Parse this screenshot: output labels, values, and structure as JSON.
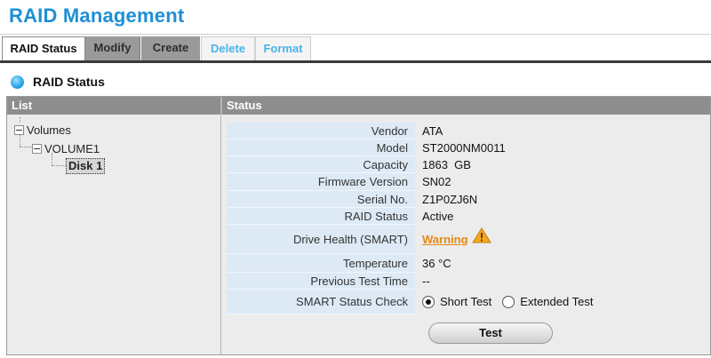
{
  "page": {
    "title": "RAID Management"
  },
  "tabs": [
    {
      "label": "RAID Status",
      "active": true
    },
    {
      "label": "Modify"
    },
    {
      "label": "Create"
    },
    {
      "label": "Delete"
    },
    {
      "label": "Format"
    }
  ],
  "section": {
    "title": "RAID Status",
    "icon": "blue-orb-icon"
  },
  "columns": {
    "list": "List",
    "status": "Status"
  },
  "tree": {
    "root": "Volumes",
    "volume": "VOLUME1",
    "disk": "Disk 1"
  },
  "details": [
    {
      "label": "Vendor",
      "value": "ATA"
    },
    {
      "label": "Model",
      "value": "ST2000NM0011"
    },
    {
      "label": "Capacity",
      "value": "1863  GB"
    },
    {
      "label": "Firmware Version",
      "value": "SN02"
    },
    {
      "label": "Serial No.",
      "value": "Z1P0ZJ6N"
    },
    {
      "label": "RAID Status",
      "value": "Active"
    },
    {
      "label": "Drive Health (SMART)",
      "value": "Warning",
      "icon": "warning-triangle-icon",
      "color": "#e48a13"
    },
    {
      "label": "Temperature",
      "value": "36 °C"
    },
    {
      "label": "Previous Test Time",
      "value": "--"
    },
    {
      "label": "SMART Status Check",
      "options": [
        "Short Test",
        "Extended Test"
      ],
      "selected": "Short Test"
    }
  ],
  "actions": {
    "test_label": "Test"
  },
  "colors": {
    "title": "#1e8fd6",
    "tab_link": "#4ab3ea",
    "label_bg": "#ddeaf6",
    "warning": "#e48a13"
  }
}
